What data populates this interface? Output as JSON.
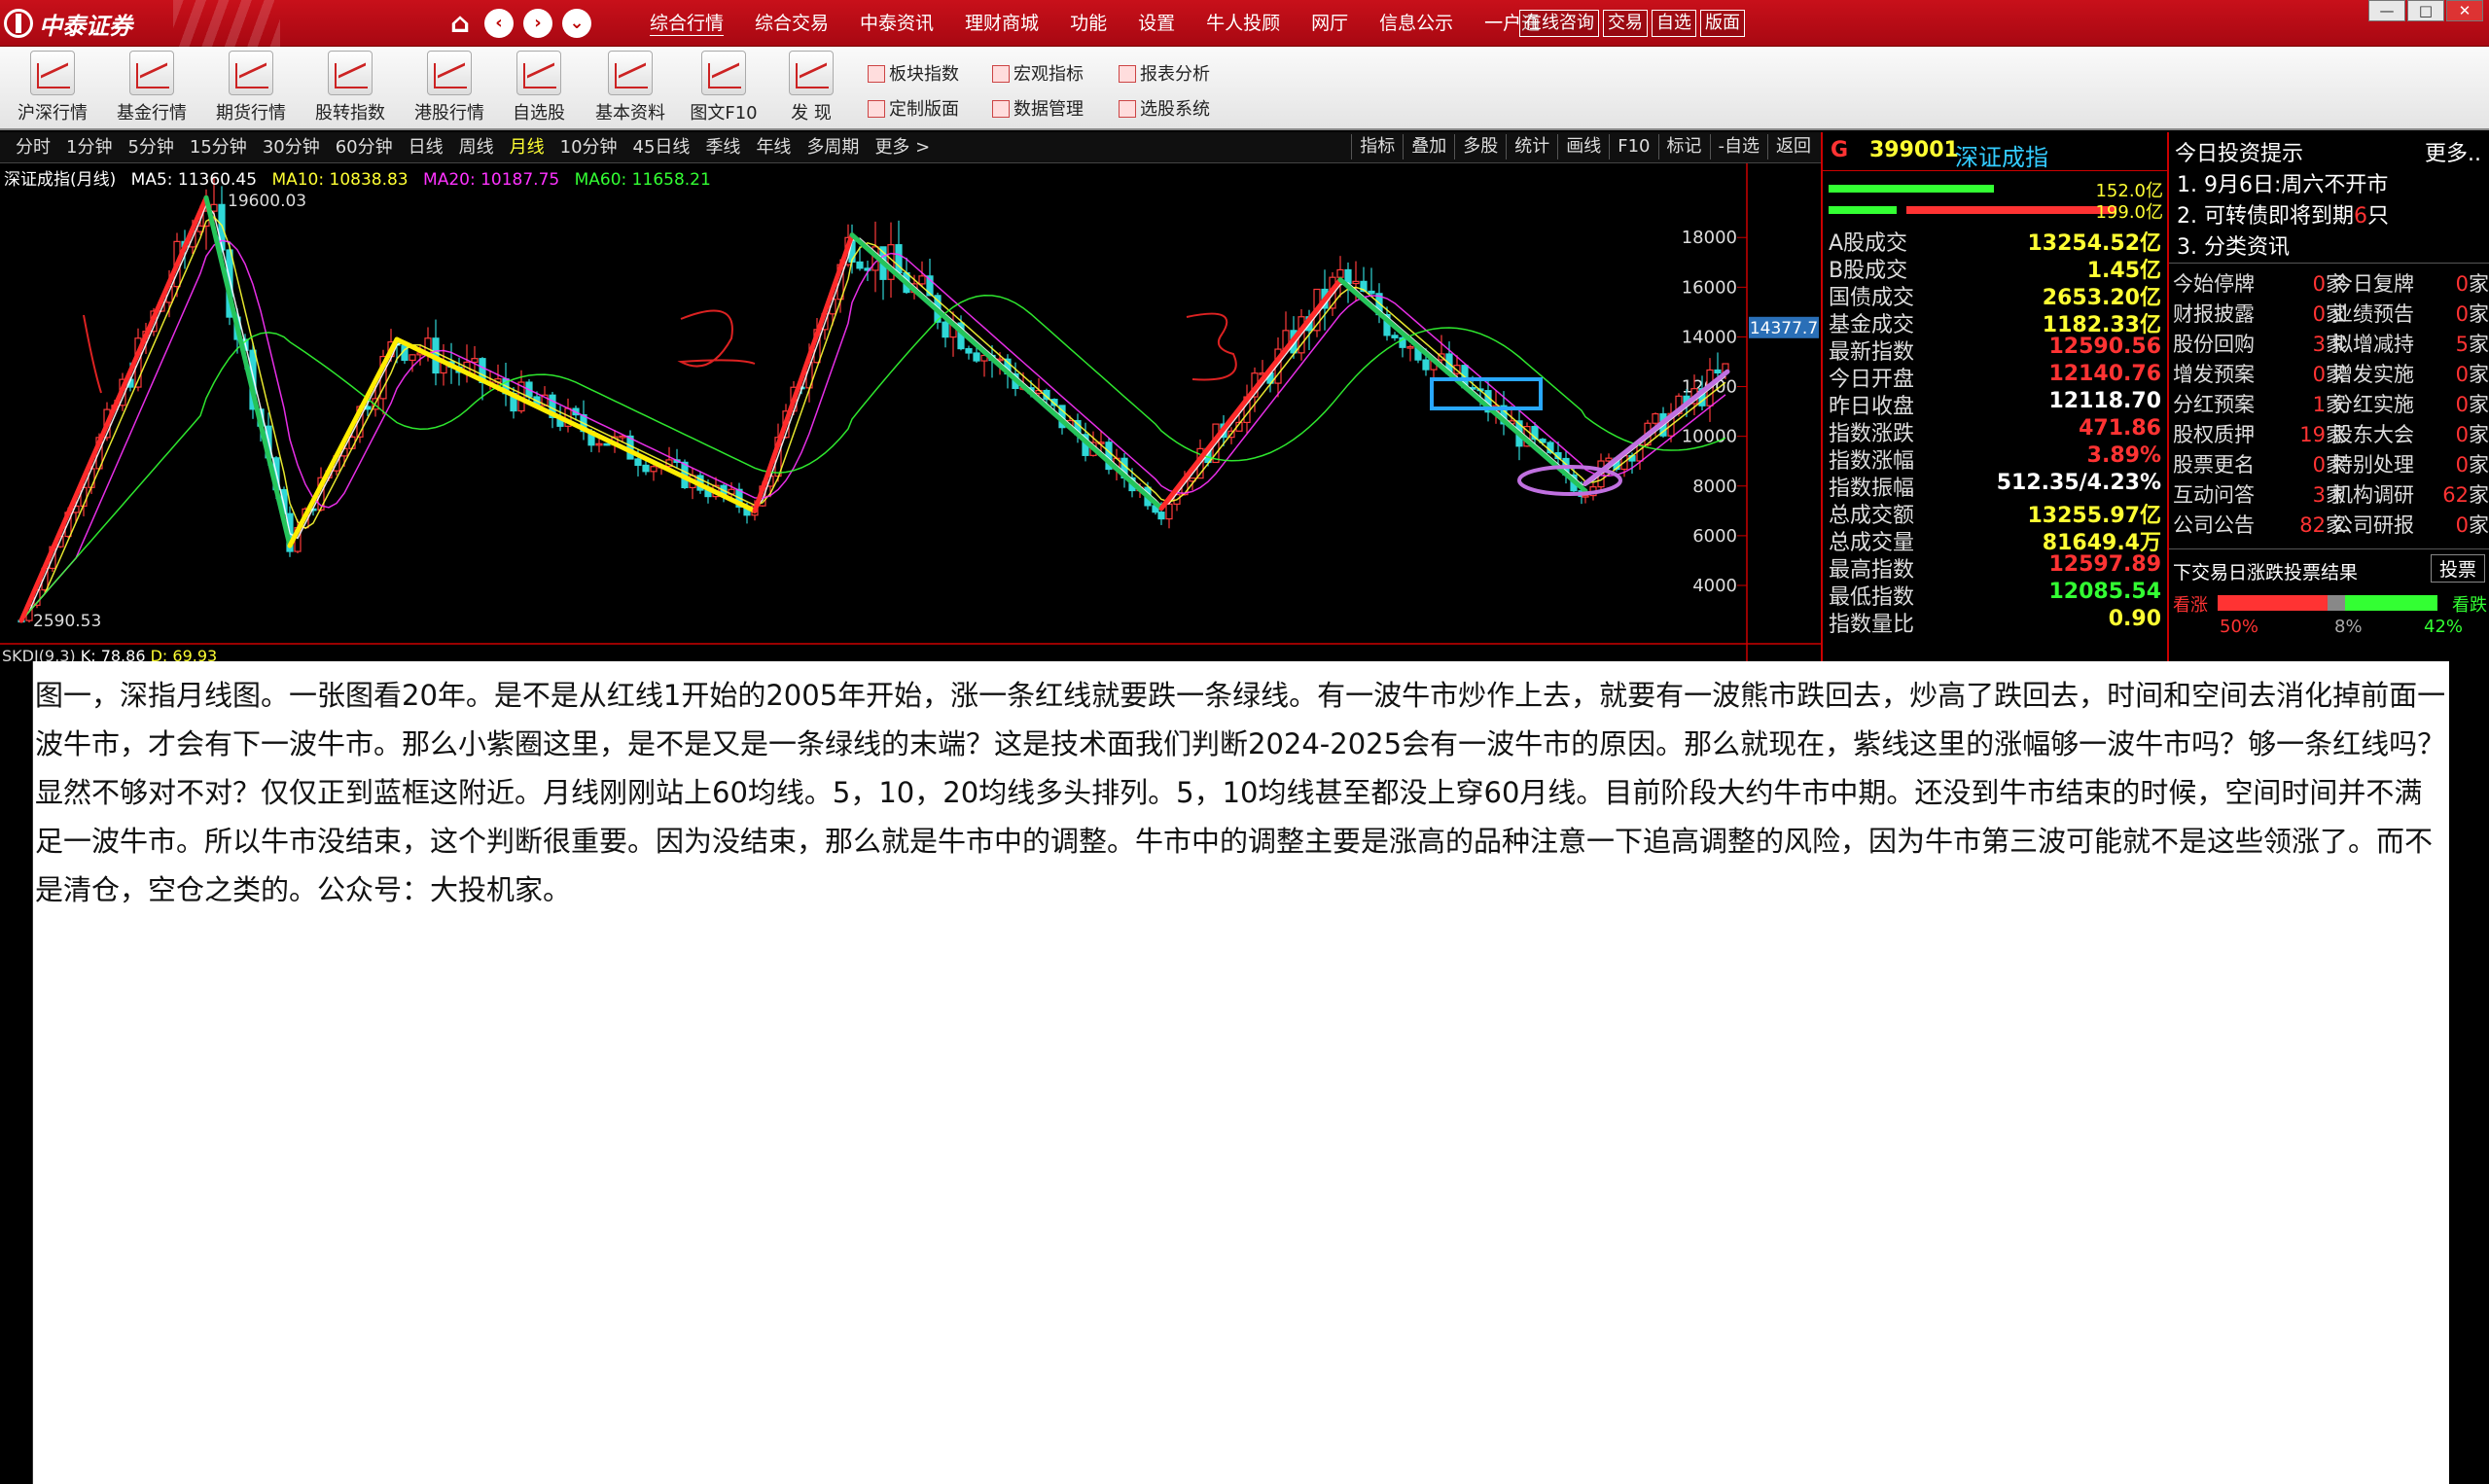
{
  "titlebar": {
    "brand": "中泰证券",
    "menu": [
      "综合行情",
      "综合交易",
      "中泰资讯",
      "理财商城",
      "功能",
      "设置",
      "牛人投顾",
      "网厅",
      "信息公示",
      "一户通"
    ],
    "right_buttons": [
      "在线咨询",
      "交易",
      "自选",
      "版面"
    ],
    "window_controls": [
      "—",
      "□",
      "✕"
    ]
  },
  "toolbar": {
    "tools": [
      "沪深行情",
      "基金行情",
      "期货行情",
      "股转指数",
      "港股行情",
      "自选股",
      "基本资料",
      "图文F10",
      "发 现"
    ],
    "mini_tools": [
      "板块指数",
      "宏观指标",
      "报表分析",
      "定制版面",
      "数据管理",
      "选股系统"
    ]
  },
  "periodbar": {
    "periods": [
      "分时",
      "1分钟",
      "5分钟",
      "15分钟",
      "30分钟",
      "60分钟",
      "日线",
      "周线",
      "月线",
      "10分钟",
      "45日线",
      "季线",
      "年线",
      "多周期",
      "更多 >"
    ],
    "active_period": "月线",
    "right_tools": [
      "指标",
      "叠加",
      "多股",
      "统计",
      "画线",
      "F10",
      "标记",
      "-自选",
      "返回"
    ]
  },
  "chart": {
    "title": "深证成指(月线)",
    "ma5": "MA5: 11360.45",
    "ma10": "MA10: 10838.83",
    "ma20": "MA20: 10187.75",
    "ma60": "MA60: 11658.21",
    "high_label": "19600.03",
    "low_label": "2590.53",
    "current_price_tag": "14377.7",
    "ma_colors": {
      "ma5": "#ffffff",
      "ma10": "#ffff33",
      "ma20": "#ff33ff",
      "ma60": "#33ff33"
    },
    "hand_labels": [
      "1",
      "2",
      "3"
    ],
    "kdj": {
      "label": "SKDJ(9,3)",
      "k": "K: 78.86",
      "d": "D: 69.93"
    }
  },
  "chart_data": {
    "type": "candlestick",
    "title": "深证成指(月线)",
    "yaxis_ticks": [
      4000,
      6000,
      8000,
      10000,
      12000,
      14000,
      16000,
      18000
    ],
    "ylim": [
      2200,
      20200
    ],
    "annotated_high": 19600.03,
    "annotated_low": 2590.53,
    "last_price": 14377.7,
    "trend_segments": [
      {
        "color": "red",
        "from": 2590,
        "to": 19600
      },
      {
        "color": "green",
        "from": 19600,
        "to": 5600
      },
      {
        "color": "yellow",
        "from": 5600,
        "to": 13900
      },
      {
        "color": "yellow",
        "from": 13900,
        "to": 7000
      },
      {
        "color": "red",
        "from": 7000,
        "to": 18100
      },
      {
        "color": "green",
        "from": 18100,
        "to": 7100
      },
      {
        "color": "red",
        "from": 7100,
        "to": 16300
      },
      {
        "color": "green",
        "from": 16300,
        "to": 7800
      },
      {
        "color": "purple",
        "from": 8100,
        "to": 12600
      }
    ]
  },
  "quote": {
    "g": "G",
    "code": "399001",
    "name": "深证成指",
    "bar_values": [
      "152.0亿",
      "199.0亿"
    ],
    "rows": [
      {
        "k": "A股成交",
        "v": "13254.52亿",
        "c": "yellow"
      },
      {
        "k": "B股成交",
        "v": "1.45亿",
        "c": "yellow"
      },
      {
        "k": "国债成交",
        "v": "2653.20亿",
        "c": "yellow"
      },
      {
        "k": "基金成交",
        "v": "1182.33亿",
        "c": "yellow"
      },
      {
        "k": "最新指数",
        "v": "12590.56",
        "c": "red"
      },
      {
        "k": "今日开盘",
        "v": "12140.76",
        "c": "red"
      },
      {
        "k": "昨日收盘",
        "v": "12118.70",
        "c": "white"
      },
      {
        "k": "指数涨跌",
        "v": "471.86",
        "c": "red"
      },
      {
        "k": "指数涨幅",
        "v": "3.89%",
        "c": "red"
      },
      {
        "k": "指数振幅",
        "v": "512.35/4.23%",
        "c": "white"
      },
      {
        "k": "总成交额",
        "v": "13255.97亿",
        "c": "yellow"
      },
      {
        "k": "总成交量",
        "v": "81649.4万",
        "c": "yellow"
      },
      {
        "k": "最高指数",
        "v": "12597.89",
        "c": "red"
      },
      {
        "k": "最低指数",
        "v": "12085.54",
        "c": "green"
      },
      {
        "k": "指数量比",
        "v": "0.90",
        "c": "yellow"
      }
    ]
  },
  "tips": {
    "title": "今日投资提示",
    "more": "更多..",
    "line1_prefix": "1. 9月6日:",
    "line1_text": "周六不开市",
    "line2_prefix": "2. 可转债即将到期",
    "line2_num": "6",
    "line2_suffix": "只",
    "line3": "3. 分类资讯",
    "rows": [
      {
        "l1": "今始停牌",
        "c1": "0",
        "l2": "今日复牌",
        "c2": "0"
      },
      {
        "l1": "财报披露",
        "c1": "0",
        "l2": "业绩预告",
        "c2": "0"
      },
      {
        "l1": "股份回购",
        "c1": "3",
        "l2": "拟增减持",
        "c2": "5"
      },
      {
        "l1": "增发预案",
        "c1": "0",
        "l2": "增发实施",
        "c2": "0"
      },
      {
        "l1": "分红预案",
        "c1": "1",
        "l2": "分红实施",
        "c2": "0"
      },
      {
        "l1": "股权质押",
        "c1": "19",
        "l2": "股东大会",
        "c2": "0"
      },
      {
        "l1": "股票更名",
        "c1": "0",
        "l2": "特别处理",
        "c2": "0"
      },
      {
        "l1": "互动问答",
        "c1": "3",
        "l2": "机构调研",
        "c2": "62"
      },
      {
        "l1": "公司公告",
        "c1": "82",
        "l2": "公司研报",
        "c2": "0"
      }
    ],
    "unit": "家",
    "vote_title": "下交易日涨跌投票结果",
    "vote_btn": "投票",
    "vote_up": "看涨",
    "vote_down": "看跌",
    "vote_up_pct": "50%",
    "vote_flat_pct": "8%",
    "vote_down_pct": "42%",
    "vote_up_frac": 0.5,
    "vote_flat_frac": 0.08,
    "vote_down_frac": 0.42
  },
  "article": {
    "text": "图一，深指月线图。一张图看20年。是不是从红线1开始的2005年开始，涨一条红线就要跌一条绿线。有一波牛市炒作上去，就要有一波熊市跌回去，炒高了跌回去，时间和空间去消化掉前面一波牛市，才会有下一波牛市。那么小紫圈这里，是不是又是一条绿线的末端？这是技术面我们判断2024-2025会有一波牛市的原因。那么就现在，紫线这里的涨幅够一波牛市吗？够一条红线吗？显然不够对不对？仅仅正到蓝框这附近。月线刚刚站上60均线。5，10，20均线多头排列。5，10均线甚至都没上穿60月线。目前阶段大约牛市中期。还没到牛市结束的时候，空间时间并不满足一波牛市。所以牛市没结束，这个判断很重要。因为没结束，那么就是牛市中的调整。牛市中的调整主要是涨高的品种注意一下追高调整的风险，因为牛市第三波可能就不是这些领涨了。而不是清仓，空仓之类的。公众号：大投机家。"
  }
}
